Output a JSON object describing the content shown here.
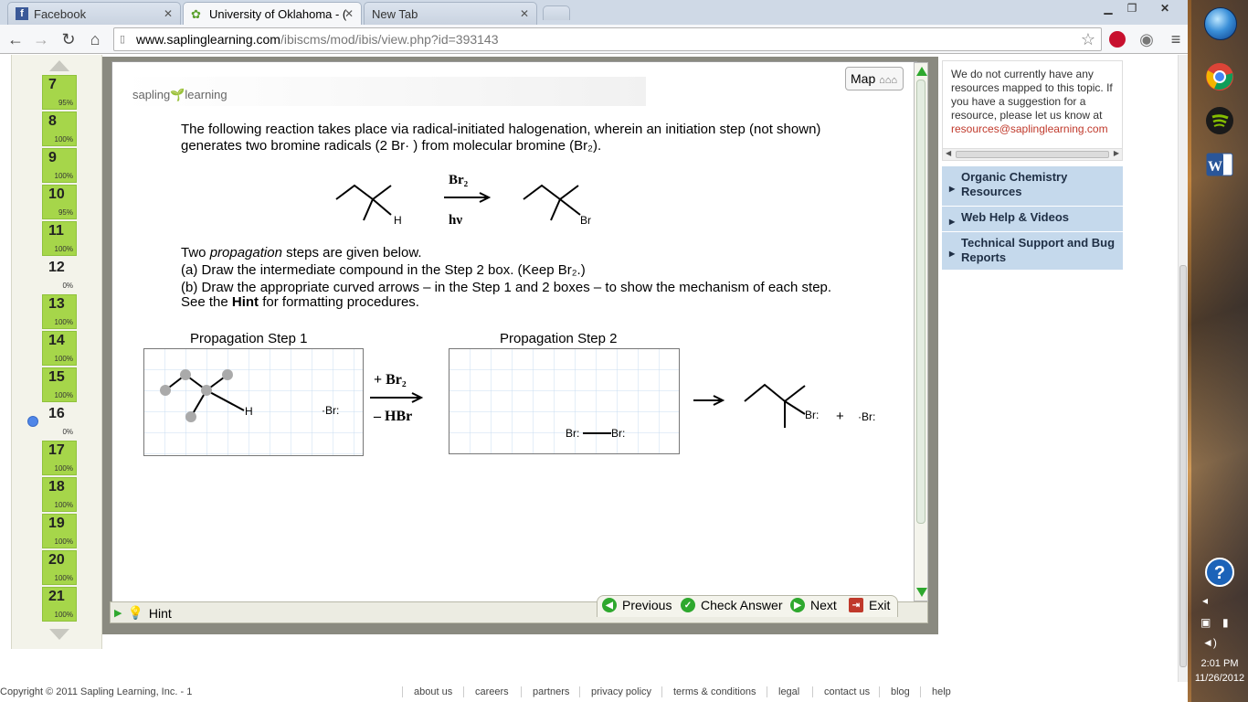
{
  "browser": {
    "tabs": [
      {
        "label": "Facebook",
        "active": false
      },
      {
        "label": "University of Oklahoma - (",
        "active": true
      },
      {
        "label": "New Tab",
        "active": false
      }
    ],
    "url_host": "www.saplinglearning.com",
    "url_path": "/ibiscms/mod/ibis/view.php?id=393143"
  },
  "question_nav": {
    "items": [
      {
        "num": "7",
        "pct": "95%"
      },
      {
        "num": "8",
        "pct": "100%"
      },
      {
        "num": "9",
        "pct": "100%"
      },
      {
        "num": "10",
        "pct": "95%"
      },
      {
        "num": "11",
        "pct": "100%"
      },
      {
        "num": "12",
        "pct": "0%"
      },
      {
        "num": "13",
        "pct": "100%"
      },
      {
        "num": "14",
        "pct": "100%"
      },
      {
        "num": "15",
        "pct": "100%"
      },
      {
        "num": "16",
        "pct": "0%"
      },
      {
        "num": "17",
        "pct": "100%"
      },
      {
        "num": "18",
        "pct": "100%"
      },
      {
        "num": "19",
        "pct": "100%"
      },
      {
        "num": "20",
        "pct": "100%"
      },
      {
        "num": "21",
        "pct": "100%"
      }
    ],
    "current_index": 9
  },
  "question": {
    "logo_text_1": "sapling",
    "logo_text_2": "learning",
    "map_label": "Map",
    "stem_line1": "The following reaction takes place via radical-initiated halogenation, wherein an initiation step (not shown)",
    "stem_line2": "generates two bromine radicals (2 Br· ) from molecular bromine (Br₂).",
    "reagent_top": "Br₂",
    "reagent_bottom": "hν",
    "h_label": "H",
    "br_label": "Br",
    "steps_intro_1": "Two ",
    "steps_intro_em": "propagation",
    "steps_intro_2": " steps are given below.",
    "instr_a": "(a) Draw the intermediate compound in the Step 2 box. (Keep Br₂.)",
    "instr_b": "(b) Draw the appropriate curved arrows –  in the Step 1 and 2 boxes –  to show the mechanism of each step.",
    "hint_line_1": "See the ",
    "hint_line_bold": "Hint",
    "hint_line_2": " for formatting procedures.",
    "step1_title": "Propagation Step 1",
    "step2_title": "Propagation Step 2",
    "plus_br2": "+ Br₂",
    "minus_hbr": "– HBr",
    "br_radical": "·Br:",
    "plus_sign": "+",
    "product_br": "Br:"
  },
  "footer_nav": {
    "hint": "Hint",
    "previous": "Previous",
    "check": "Check Answer",
    "next": "Next",
    "exit": "Exit"
  },
  "sidebar": {
    "message": "We do not currently have any resources mapped to this topic. If you have a suggestion for a resource, please let us know at",
    "email": "resources@saplinglearning.com",
    "links": [
      "Organic Chemistry Resources",
      "Web Help & Videos",
      "Technical Support and Bug Reports"
    ]
  },
  "page_footer": {
    "copyright": "Copyright © 2011 Sapling Learning, Inc. - 1",
    "links": [
      "about us",
      "careers",
      "partners",
      "privacy policy",
      "terms & conditions",
      "legal",
      "contact us",
      "blog",
      "help"
    ]
  },
  "system": {
    "time": "2:01 PM",
    "date": "11/26/2012"
  },
  "colors": {
    "complete": "#a6d64a",
    "side_link_bg": "#c5d9ec",
    "email": "#c0392b"
  }
}
